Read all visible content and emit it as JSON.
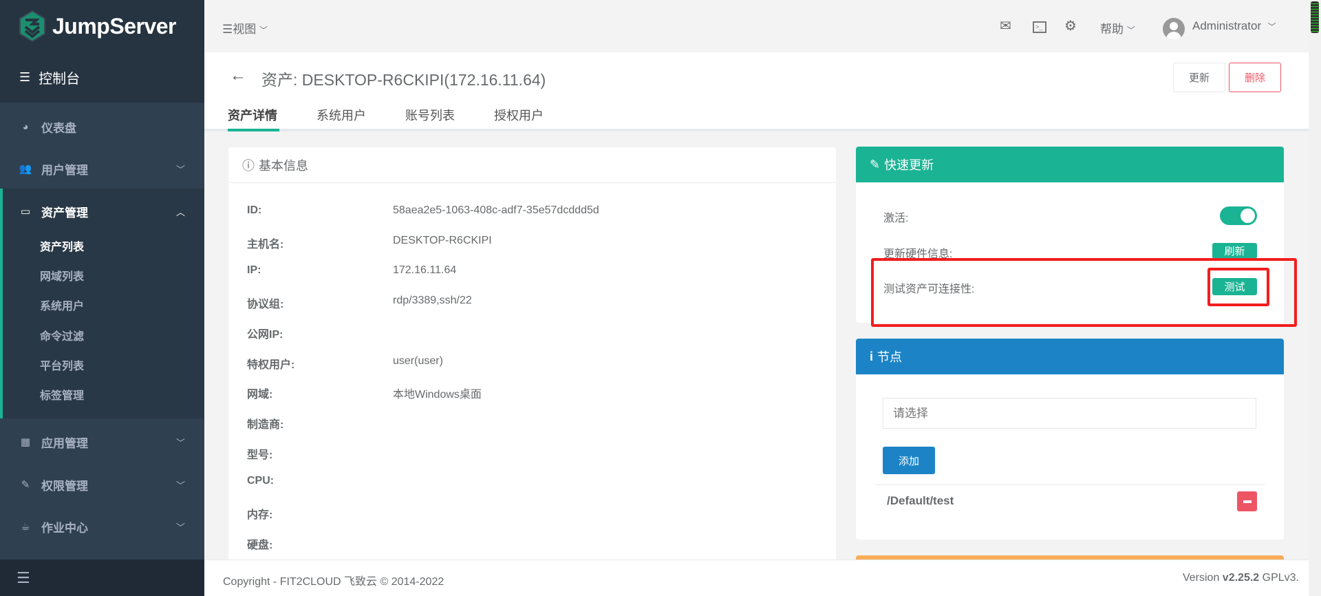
{
  "app": {
    "name": "JumpServer"
  },
  "sidebar": {
    "console": "控制台",
    "items": [
      {
        "label": "仪表盘",
        "icon": "dashboard-icon"
      },
      {
        "label": "用户管理",
        "icon": "users-icon"
      },
      {
        "label": "资产管理",
        "icon": "inbox-icon"
      },
      {
        "label": "应用管理",
        "icon": "grid-icon"
      },
      {
        "label": "权限管理",
        "icon": "edit-icon"
      },
      {
        "label": "作业中心",
        "icon": "coffee-icon"
      }
    ],
    "asset_sub": [
      "资产列表",
      "网域列表",
      "系统用户",
      "命令过滤",
      "平台列表",
      "标签管理"
    ]
  },
  "topbar": {
    "view": "视图",
    "help": "帮助",
    "user": "Administrator"
  },
  "page": {
    "title": "资产: DESKTOP-R6CKIPI(172.16.11.64)",
    "update": "更新",
    "delete": "删除",
    "tabs": [
      "资产详情",
      "系统用户",
      "账号列表",
      "授权用户"
    ]
  },
  "basic": {
    "title": "基本信息",
    "rows": [
      {
        "label": "ID:",
        "value": "58aea2e5-1063-408c-adf7-35e57dcddd5d"
      },
      {
        "label": "主机名:",
        "value": "DESKTOP-R6CKIPI"
      },
      {
        "label": "IP:",
        "value": "172.16.11.64"
      },
      {
        "label": "协议组:",
        "value": "rdp/3389,ssh/22"
      },
      {
        "label": "公网IP:",
        "value": ""
      },
      {
        "label": "特权用户:",
        "value": "user(user)"
      },
      {
        "label": "网域:",
        "value": "本地Windows桌面"
      },
      {
        "label": "制造商:",
        "value": ""
      },
      {
        "label": "型号:",
        "value": ""
      },
      {
        "label": "CPU:",
        "value": ""
      },
      {
        "label": "内存:",
        "value": ""
      },
      {
        "label": "硬盘:",
        "value": ""
      }
    ]
  },
  "quick": {
    "title": "快速更新",
    "active_label": "激活:",
    "active": true,
    "hw_label": "更新硬件信息:",
    "hw_btn": "刷新",
    "test_label": "测试资产可连接性:",
    "test_btn": "测试"
  },
  "nodes": {
    "title": "节点",
    "placeholder": "请选择",
    "add": "添加",
    "items": [
      "/Default/test"
    ]
  },
  "footer": {
    "copyright": "Copyright - FIT2CLOUD 飞致云 © 2014-2022",
    "version_prefix": "Version ",
    "version": "v2.25.2",
    "license": " GPLv3."
  },
  "colors": {
    "primary": "#1ab394",
    "info": "#1c84c6",
    "danger": "#ed5565",
    "warning": "#f8ac59"
  }
}
